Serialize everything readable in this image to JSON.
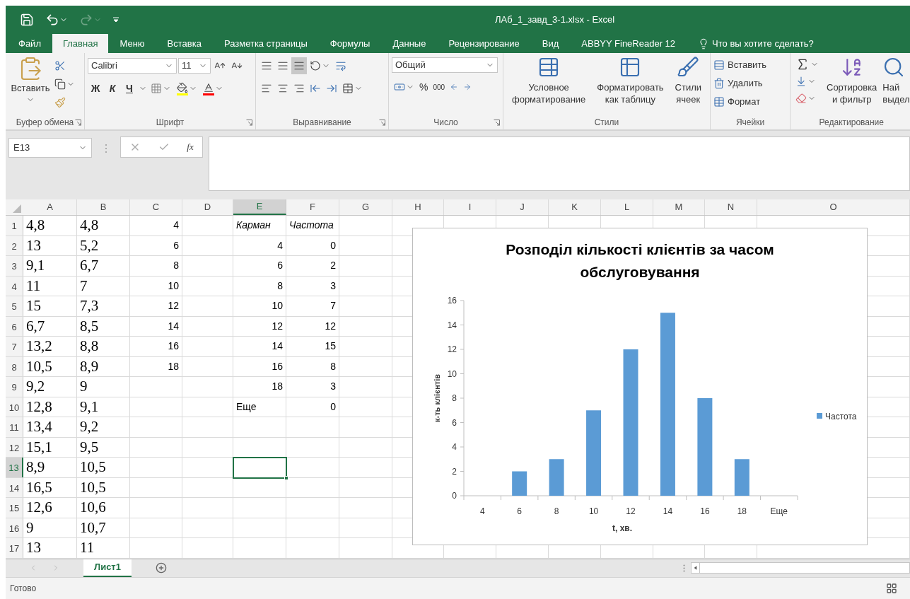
{
  "window": {
    "title": "ЛАб_1_завд_3-1.xlsx - Excel"
  },
  "tabs": [
    {
      "label": "Файл",
      "selected": false
    },
    {
      "label": "Главная",
      "selected": true
    },
    {
      "label": "Меню",
      "selected": false
    },
    {
      "label": "Вставка",
      "selected": false
    },
    {
      "label": "Разметка страницы",
      "selected": false
    },
    {
      "label": "Формулы",
      "selected": false
    },
    {
      "label": "Данные",
      "selected": false
    },
    {
      "label": "Рецензирование",
      "selected": false
    },
    {
      "label": "Вид",
      "selected": false
    },
    {
      "label": "ABBYY FineReader 12",
      "selected": false
    }
  ],
  "tell_me": {
    "placeholder": "Что вы хотите сделать?"
  },
  "ribbon": {
    "clipboard": {
      "label": "Буфер обмена",
      "paste": "Вставить"
    },
    "font": {
      "label": "Шрифт",
      "family": "Calibri",
      "size": "11",
      "bold": "Ж",
      "italic": "К",
      "underline": "Ч"
    },
    "alignment": {
      "label": "Выравнивание"
    },
    "number": {
      "label": "Число",
      "format": "Общий",
      "percent": "%",
      "thousands": "000"
    },
    "styles": {
      "label": "Стили",
      "buttons": [
        "Условное\nформатирование",
        "Форматировать\nкак таблицу",
        "Стили\nячеек"
      ]
    },
    "cells": {
      "label": "Ячейки",
      "buttons": [
        "Вставить",
        "Удалить",
        "Формат"
      ]
    },
    "editing": {
      "label": "Редактирование",
      "sort": "Сортировка\nи фильтр",
      "find": "Най\nвыдел"
    }
  },
  "formula_bar": {
    "name_box": "E13",
    "function_label": "fx"
  },
  "columns": [
    {
      "label": "A",
      "selected": false
    },
    {
      "label": "B",
      "selected": false
    },
    {
      "label": "C",
      "selected": false
    },
    {
      "label": "D",
      "selected": false
    },
    {
      "label": "E",
      "selected": true
    },
    {
      "label": "F",
      "selected": false
    },
    {
      "label": "G",
      "selected": false
    },
    {
      "label": "H",
      "selected": false
    },
    {
      "label": "I",
      "selected": false
    },
    {
      "label": "J",
      "selected": false
    },
    {
      "label": "K",
      "selected": false
    },
    {
      "label": "L",
      "selected": false
    },
    {
      "label": "M",
      "selected": false
    },
    {
      "label": "N",
      "selected": false
    },
    {
      "label": "O",
      "selected": false
    }
  ],
  "rows": [
    {
      "num": "1",
      "selected": false,
      "kind": "header",
      "A": "4,8",
      "B": "4,8",
      "C": "4",
      "E": "Карман",
      "F": "Частота"
    },
    {
      "num": "2",
      "selected": false,
      "kind": "data",
      "A": "13",
      "B": "5,2",
      "C": "6",
      "E": "4",
      "F": "0"
    },
    {
      "num": "3",
      "selected": false,
      "kind": "data",
      "A": "9,1",
      "B": "6,7",
      "C": "8",
      "E": "6",
      "F": "2"
    },
    {
      "num": "4",
      "selected": false,
      "kind": "data",
      "A": "11",
      "B": "7",
      "C": "10",
      "E": "8",
      "F": "3"
    },
    {
      "num": "5",
      "selected": false,
      "kind": "data",
      "A": "15",
      "B": "7,3",
      "C": "12",
      "E": "10",
      "F": "7"
    },
    {
      "num": "6",
      "selected": false,
      "kind": "data",
      "A": "6,7",
      "B": "8,5",
      "C": "14",
      "E": "12",
      "F": "12"
    },
    {
      "num": "7",
      "selected": false,
      "kind": "data",
      "A": "13,2",
      "B": "8,8",
      "C": "16",
      "E": "14",
      "F": "15"
    },
    {
      "num": "8",
      "selected": false,
      "kind": "data",
      "A": "10,5",
      "B": "8,9",
      "C": "18",
      "E": "16",
      "F": "8"
    },
    {
      "num": "9",
      "selected": false,
      "kind": "data",
      "A": "9,2",
      "B": "9",
      "E": "18",
      "F": "3"
    },
    {
      "num": "10",
      "selected": false,
      "kind": "label",
      "A": "12,8",
      "B": "9,1",
      "E": "Еще",
      "F": "0"
    },
    {
      "num": "11",
      "selected": false,
      "kind": "data",
      "A": "13,4",
      "B": "9,2"
    },
    {
      "num": "12",
      "selected": false,
      "kind": "data",
      "A": "15,1",
      "B": "9,5"
    },
    {
      "num": "13",
      "selected": true,
      "kind": "data",
      "A": "8,9",
      "B": "10,5"
    },
    {
      "num": "14",
      "selected": false,
      "kind": "data",
      "A": "16,5",
      "B": "10,5"
    },
    {
      "num": "15",
      "selected": false,
      "kind": "data",
      "A": "12,6",
      "B": "10,6"
    },
    {
      "num": "16",
      "selected": false,
      "kind": "data",
      "A": "9",
      "B": "10,7"
    },
    {
      "num": "17",
      "selected": false,
      "kind": "data",
      "A": "13",
      "B": "11"
    }
  ],
  "chart": {
    "chart_data": {
      "type": "bar",
      "title": "Розподіл кількості клієнтів за часом обслуговування",
      "xlabel": "t, хв.",
      "ylabel": "к-ть клієнтів",
      "categories": [
        "4",
        "6",
        "8",
        "10",
        "12",
        "14",
        "16",
        "18",
        "Еще"
      ],
      "series": [
        {
          "name": "Частота",
          "color": "#5b9bd5",
          "values": [
            0,
            2,
            3,
            7,
            12,
            15,
            8,
            3,
            0
          ]
        }
      ],
      "ylim": [
        0,
        16
      ],
      "yticks": [
        0,
        2,
        4,
        6,
        8,
        10,
        12,
        14,
        16
      ]
    }
  },
  "sheet_tabs": [
    {
      "label": "Лист1",
      "selected": true
    }
  ],
  "status_bar": {
    "text": "Готово"
  }
}
